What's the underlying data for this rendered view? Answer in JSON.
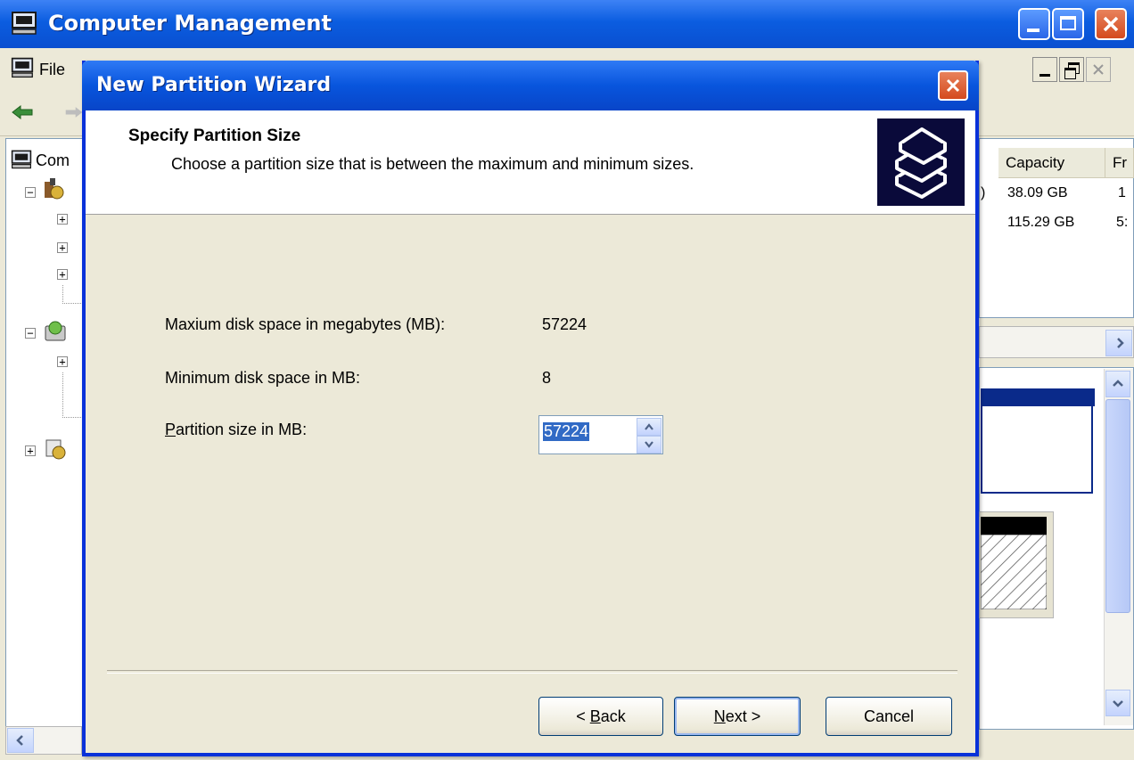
{
  "main_window": {
    "title": "Computer Management",
    "menu_first": "File",
    "tree_root_label": "Com"
  },
  "list": {
    "columns": [
      "Capacity",
      "Fr"
    ],
    "rows": [
      {
        "capacity": "38.09 GB",
        "free": "1"
      },
      {
        "capacity": "115.29 GB",
        "free": "5:"
      }
    ]
  },
  "wizard": {
    "title": "New Partition Wizard",
    "header_title": "Specify Partition Size",
    "header_subtitle": "Choose a partition size that is between the maximum and minimum sizes.",
    "max_label": "Maxium disk space in megabytes (MB):",
    "max_value": "57224",
    "min_label": "Minimum disk space in MB:",
    "min_value": "8",
    "size_label_accel": "P",
    "size_label_rest": "artition size in MB:",
    "size_value": "57224",
    "back_accel": "B",
    "back_rest": "ack",
    "back_prefix": "< ",
    "next_accel": "N",
    "next_rest": "ext >",
    "cancel_label": "Cancel"
  },
  "colors": {
    "titlebar_blue": "#0b5de0",
    "selection_blue": "#316ac5",
    "dialog_bg": "#ece9d8"
  }
}
